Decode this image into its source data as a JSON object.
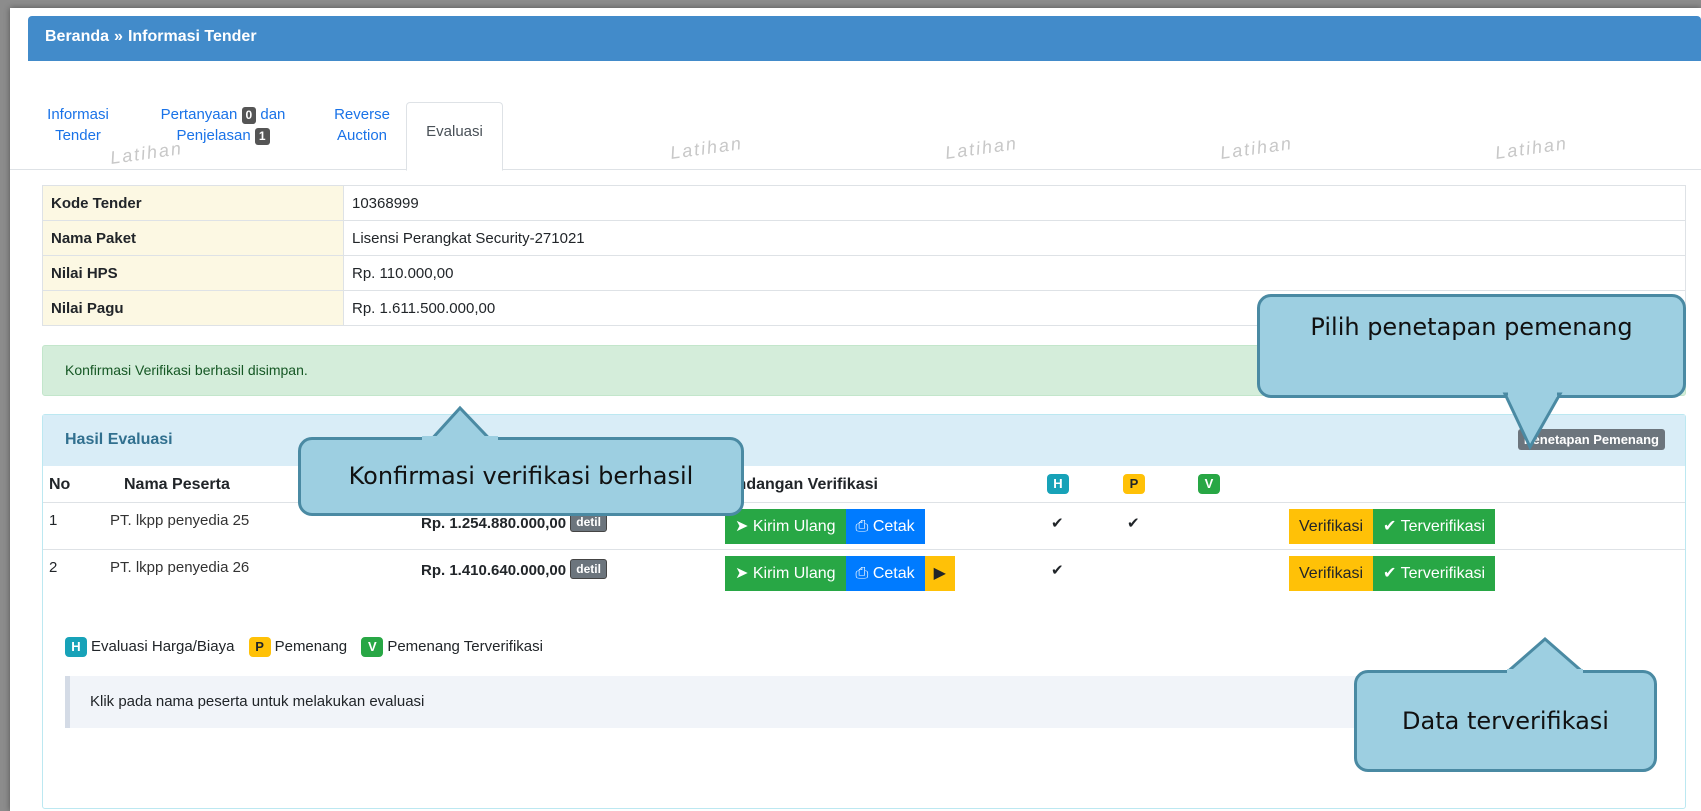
{
  "breadcrumb": {
    "home": "Beranda",
    "separator": "»",
    "current": "Informasi Tender"
  },
  "tabs": [
    {
      "line1": "Informasi",
      "line2": "Tender"
    },
    {
      "line1": "Pertanyaan",
      "badge1": "0",
      "line1b": "dan",
      "line2": "Penjelasan",
      "badge2": "1"
    },
    {
      "line1": "Reverse",
      "line2": "Auction"
    },
    {
      "label": "Evaluasi"
    }
  ],
  "watermark": "Latihan",
  "info": [
    {
      "key": "Kode Tender",
      "value": "10368999"
    },
    {
      "key": "Nama Paket",
      "value": "Lisensi Perangkat Security-271021"
    },
    {
      "key": "Nilai HPS",
      "value": "Rp. 110.000,00"
    },
    {
      "key": "Nilai Pagu",
      "value": "Rp. 1.611.500.000,00"
    }
  ],
  "alert": "Konfirmasi Verifikasi berhasil disimpan.",
  "panel": {
    "title": "Hasil Evaluasi",
    "action": "Penetapan Pemenang",
    "headers": {
      "no": "No",
      "name": "Nama Peserta",
      "invite": "Undangan Verifikasi",
      "h": "H",
      "p": "P",
      "v": "V"
    },
    "rows": [
      {
        "no": "1",
        "name": "PT. lkpp penyedia 25",
        "price": "Rp. 1.254.880.000,00",
        "detil": "detil",
        "resend": "Kirim Ulang",
        "print": "Cetak",
        "h": "✔",
        "p": "✔",
        "verify": "Verifikasi",
        "verified": "Terverifikasi"
      },
      {
        "no": "2",
        "name": "PT. lkpp penyedia 26",
        "price": "Rp. 1.410.640.000,00",
        "detil": "detil",
        "resend": "Kirim Ulang",
        "print": "Cetak",
        "h": "✔",
        "p": "",
        "verify": "Verifikasi",
        "verified": "Terverifikasi"
      }
    ],
    "legend": {
      "h": "Evaluasi Harga/Biaya",
      "p": "Pemenang",
      "v": "Pemenang Terverifikasi"
    },
    "hint": "Klik pada nama peserta untuk melakukan evaluasi"
  },
  "callouts": {
    "winner": "Pilih penetapan pemenang",
    "confirm": "Konfirmasi verifikasi berhasil",
    "verified": "Data terverifikasi"
  },
  "colors": {
    "header": "#428bca",
    "success": "#28a745",
    "primary": "#007bff",
    "warning": "#ffc107",
    "info": "#17a2b8",
    "callout": "#9dcfe1"
  }
}
